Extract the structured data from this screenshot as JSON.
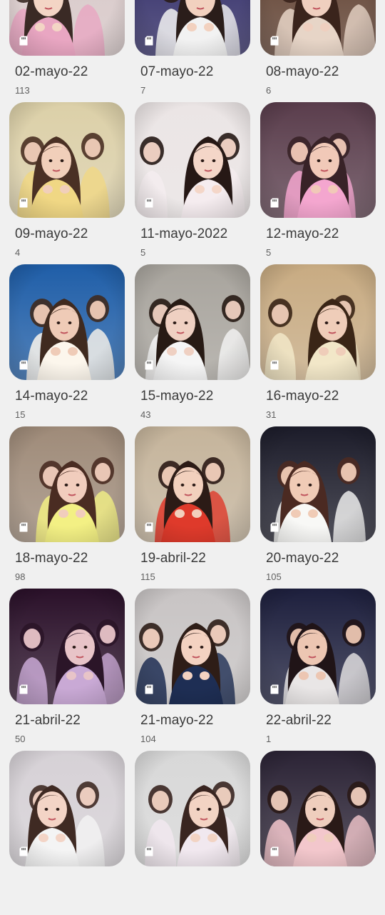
{
  "gallery": {
    "albums": [
      {
        "title": "02-mayo-22",
        "count": "113",
        "bg": "#d8c8c8",
        "accent": "#e9a6c2",
        "skin": "#f3d5c5",
        "hair": "#3a2a25"
      },
      {
        "title": "07-mayo-22",
        "count": "7",
        "bg": "#2f2a66",
        "accent": "#f2f2f2",
        "skin": "#f2d1bf",
        "hair": "#2a1d1a"
      },
      {
        "title": "08-mayo-22",
        "count": "6",
        "bg": "#5f3f2f",
        "accent": "#e7d5c7",
        "skin": "#efcfbf",
        "hair": "#3a241c"
      },
      {
        "title": "09-mayo-22",
        "count": "4",
        "bg": "#dcd0a8",
        "accent": "#f0d784",
        "skin": "#f1cfba",
        "hair": "#4a3024"
      },
      {
        "title": "11-mayo-2022",
        "count": "5",
        "bg": "#ebe5e5",
        "accent": "#f5ecef",
        "skin": "#f4d6c8",
        "hair": "#261815"
      },
      {
        "title": "12-mayo-22",
        "count": "5",
        "bg": "#5a3d4c",
        "accent": "#f4a6cf",
        "skin": "#f1c9b8",
        "hair": "#382227"
      },
      {
        "title": "14-mayo-22",
        "count": "15",
        "bg": "#1f5ea8",
        "accent": "#fcf6ec",
        "skin": "#efcbb7",
        "hair": "#3f2a1f"
      },
      {
        "title": "15-mayo-22",
        "count": "43",
        "bg": "#a8a49d",
        "accent": "#f5f5f5",
        "skin": "#efd0c2",
        "hair": "#271a14"
      },
      {
        "title": "16-mayo-22",
        "count": "31",
        "bg": "#c8ab82",
        "accent": "#f2e7c8",
        "skin": "#efcdb9",
        "hair": "#3a2516"
      },
      {
        "title": "18-mayo-22",
        "count": "98",
        "bg": "#9f8b79",
        "accent": "#f3f084",
        "skin": "#f1cdbd",
        "hair": "#4a2c22"
      },
      {
        "title": "19-abril-22",
        "count": "115",
        "bg": "#c5b49b",
        "accent": "#df3a2b",
        "skin": "#f2d0bd",
        "hair": "#2c1b16"
      },
      {
        "title": "20-mayo-22",
        "count": "105",
        "bg": "#1c1c2a",
        "accent": "#f8f8f6",
        "skin": "#f0cbb6",
        "hair": "#4b2a22"
      },
      {
        "title": "21-abril-22",
        "count": "50",
        "bg": "#2a1029",
        "accent": "#c9a9d5",
        "skin": "#e8c4c8",
        "hair": "#2b1528"
      },
      {
        "title": "21-mayo-22",
        "count": "104",
        "bg": "#c8c4c4",
        "accent": "#1e2e54",
        "skin": "#f3d2c1",
        "hair": "#2e1d17"
      },
      {
        "title": "22-abril-22",
        "count": "1",
        "bg": "#1d1f3d",
        "accent": "#e9e6e6",
        "skin": "#ecc6b2",
        "hair": "#201417"
      },
      {
        "title": "",
        "count": "",
        "bg": "#d6d1d6",
        "accent": "#f4f4f4",
        "skin": "#f3d4c6",
        "hair": "#3f2a23"
      },
      {
        "title": "",
        "count": "",
        "bg": "#d8d8d8",
        "accent": "#f1e8ef",
        "skin": "#f2d3c3",
        "hair": "#392520"
      },
      {
        "title": "",
        "count": "",
        "bg": "#2b2335",
        "accent": "#f3c7cc",
        "skin": "#efcebd",
        "hair": "#2a1a17"
      }
    ]
  }
}
